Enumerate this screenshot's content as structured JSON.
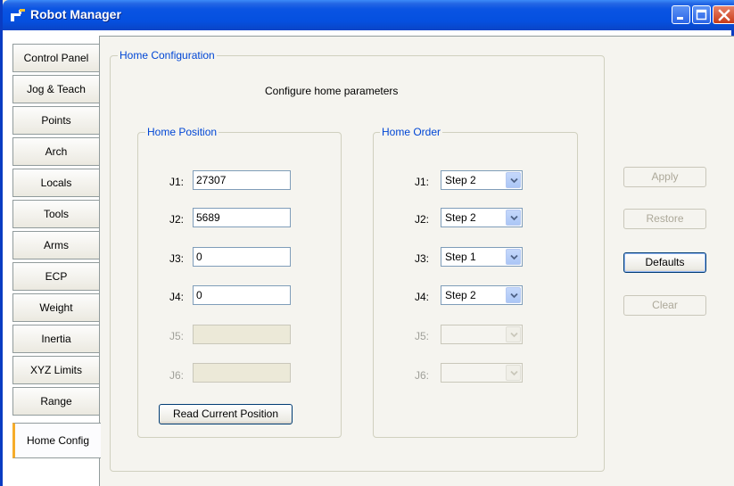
{
  "window": {
    "title": "Robot Manager"
  },
  "tabs": [
    {
      "label": "Control Panel"
    },
    {
      "label": "Jog & Teach"
    },
    {
      "label": "Points"
    },
    {
      "label": "Arch"
    },
    {
      "label": "Locals"
    },
    {
      "label": "Tools"
    },
    {
      "label": "Arms"
    },
    {
      "label": "ECP"
    },
    {
      "label": "Weight"
    },
    {
      "label": "Inertia"
    },
    {
      "label": "XYZ Limits"
    },
    {
      "label": "Range"
    },
    {
      "label": "Home Config",
      "selected": true
    }
  ],
  "home_config": {
    "group_title": "Home Configuration",
    "description": "Configure home parameters",
    "home_position": {
      "title": "Home Position",
      "joints": [
        {
          "label": "J1:",
          "value": "27307",
          "enabled": true
        },
        {
          "label": "J2:",
          "value": "5689",
          "enabled": true
        },
        {
          "label": "J3:",
          "value": "0",
          "enabled": true
        },
        {
          "label": "J4:",
          "value": "0",
          "enabled": true
        },
        {
          "label": "J5:",
          "value": "",
          "enabled": false
        },
        {
          "label": "J6:",
          "value": "",
          "enabled": false
        }
      ],
      "read_button": "Read Current Position"
    },
    "home_order": {
      "title": "Home Order",
      "joints": [
        {
          "label": "J1:",
          "value": "Step 2",
          "enabled": true
        },
        {
          "label": "J2:",
          "value": "Step 2",
          "enabled": true
        },
        {
          "label": "J3:",
          "value": "Step 1",
          "enabled": true
        },
        {
          "label": "J4:",
          "value": "Step 2",
          "enabled": true
        },
        {
          "label": "J5:",
          "value": "",
          "enabled": false
        },
        {
          "label": "J6:",
          "value": "",
          "enabled": false
        }
      ]
    }
  },
  "actions": {
    "apply": "Apply",
    "restore": "Restore",
    "defaults": "Defaults",
    "clear": "Clear"
  },
  "colors": {
    "titlebar": "#0a54e3",
    "group_title": "#0046d5",
    "active_tab_marker": "#f6ac2a"
  },
  "icons": {
    "app": "robot-manager-icon",
    "minimize": "minimize-icon",
    "maximize": "maximize-icon",
    "close": "close-icon",
    "dropdown": "chevron-down-icon"
  }
}
